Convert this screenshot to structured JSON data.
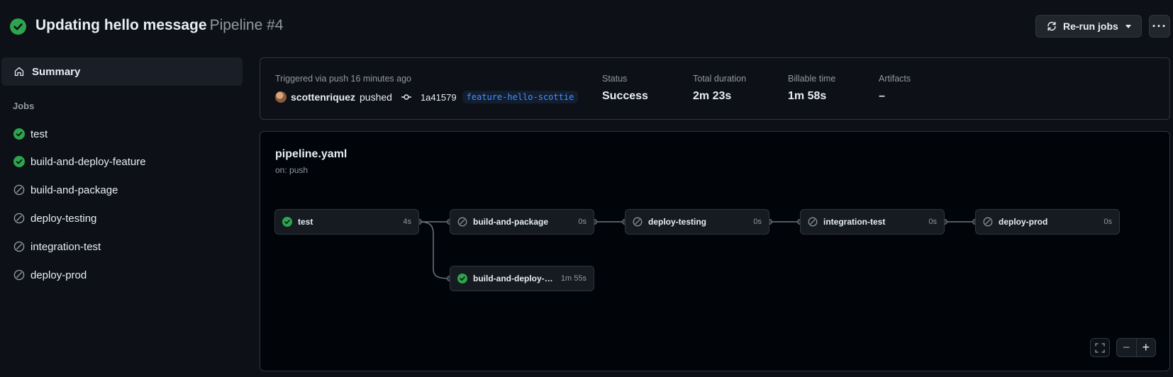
{
  "header": {
    "title": "Updating hello message",
    "subtitle": "Pipeline #4",
    "rerun_label": "Re-run jobs",
    "more_label": "···"
  },
  "sidebar": {
    "summary_label": "Summary",
    "jobs_heading": "Jobs",
    "jobs": [
      {
        "label": "test",
        "status": "success"
      },
      {
        "label": "build-and-deploy-feature",
        "status": "success"
      },
      {
        "label": "build-and-package",
        "status": "skipped"
      },
      {
        "label": "deploy-testing",
        "status": "skipped"
      },
      {
        "label": "integration-test",
        "status": "skipped"
      },
      {
        "label": "deploy-prod",
        "status": "skipped"
      }
    ]
  },
  "summary": {
    "trigger_text": "Triggered via push 16 minutes ago",
    "actor": "scottenriquez",
    "action": "pushed",
    "commit": "1a41579",
    "branch": "feature-hello-scottie",
    "status_label": "Status",
    "status_value": "Success",
    "duration_label": "Total duration",
    "duration_value": "2m 23s",
    "billable_label": "Billable time",
    "billable_value": "1m 58s",
    "artifacts_label": "Artifacts",
    "artifacts_value": "–"
  },
  "graph": {
    "file": "pipeline.yaml",
    "trigger": "on: push",
    "nodes": [
      {
        "name": "test",
        "duration": "4s",
        "status": "success"
      },
      {
        "name": "build-and-package",
        "duration": "0s",
        "status": "skipped"
      },
      {
        "name": "deploy-testing",
        "duration": "0s",
        "status": "skipped"
      },
      {
        "name": "integration-test",
        "duration": "0s",
        "status": "skipped"
      },
      {
        "name": "deploy-prod",
        "duration": "0s",
        "status": "skipped"
      },
      {
        "name": "build-and-deploy-feat...",
        "duration": "1m 55s",
        "status": "success"
      }
    ],
    "zoom_out_label": "−",
    "zoom_in_label": "+"
  },
  "colors": {
    "success": "#2da44e",
    "skipped": "#9198a1",
    "accent_link": "#4493f8"
  }
}
